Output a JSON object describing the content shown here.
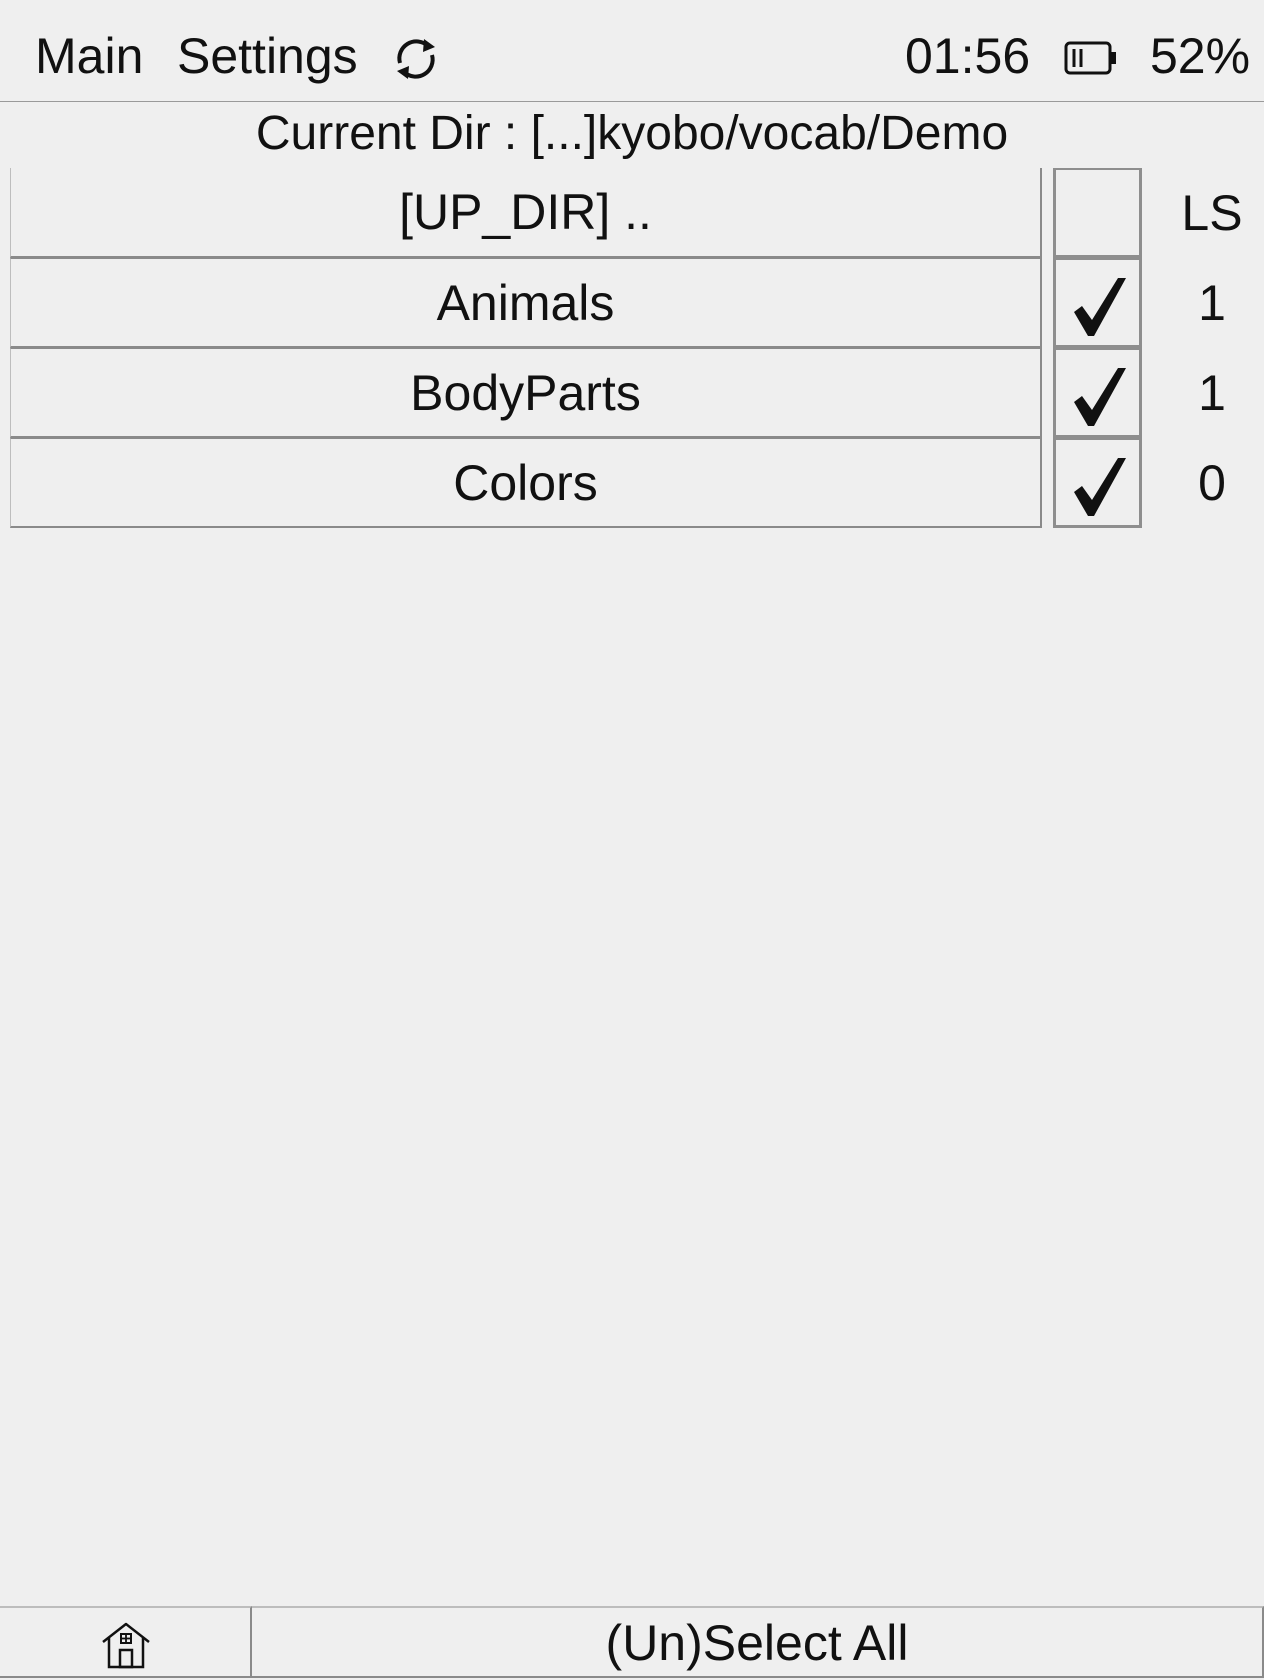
{
  "topbar": {
    "menu_main": "Main",
    "menu_settings": "Settings",
    "refresh_icon": "refresh-icon",
    "time": "01:56",
    "battery_icon": "battery-icon",
    "battery_level": 0.52,
    "battery_percent": "52%"
  },
  "current_dir": {
    "label": "Current Dir : [...]kyobo/vocab/Demo"
  },
  "list": {
    "column_ls_header": "LS",
    "rows": [
      {
        "name": "[UP_DIR] ..",
        "checked": false,
        "ls": ""
      },
      {
        "name": "Animals",
        "checked": true,
        "ls": "1"
      },
      {
        "name": "BodyParts",
        "checked": true,
        "ls": "1"
      },
      {
        "name": "Colors",
        "checked": true,
        "ls": "0"
      }
    ]
  },
  "bottombar": {
    "home_icon": "home-icon",
    "select_all_label": "(Un)Select All"
  }
}
